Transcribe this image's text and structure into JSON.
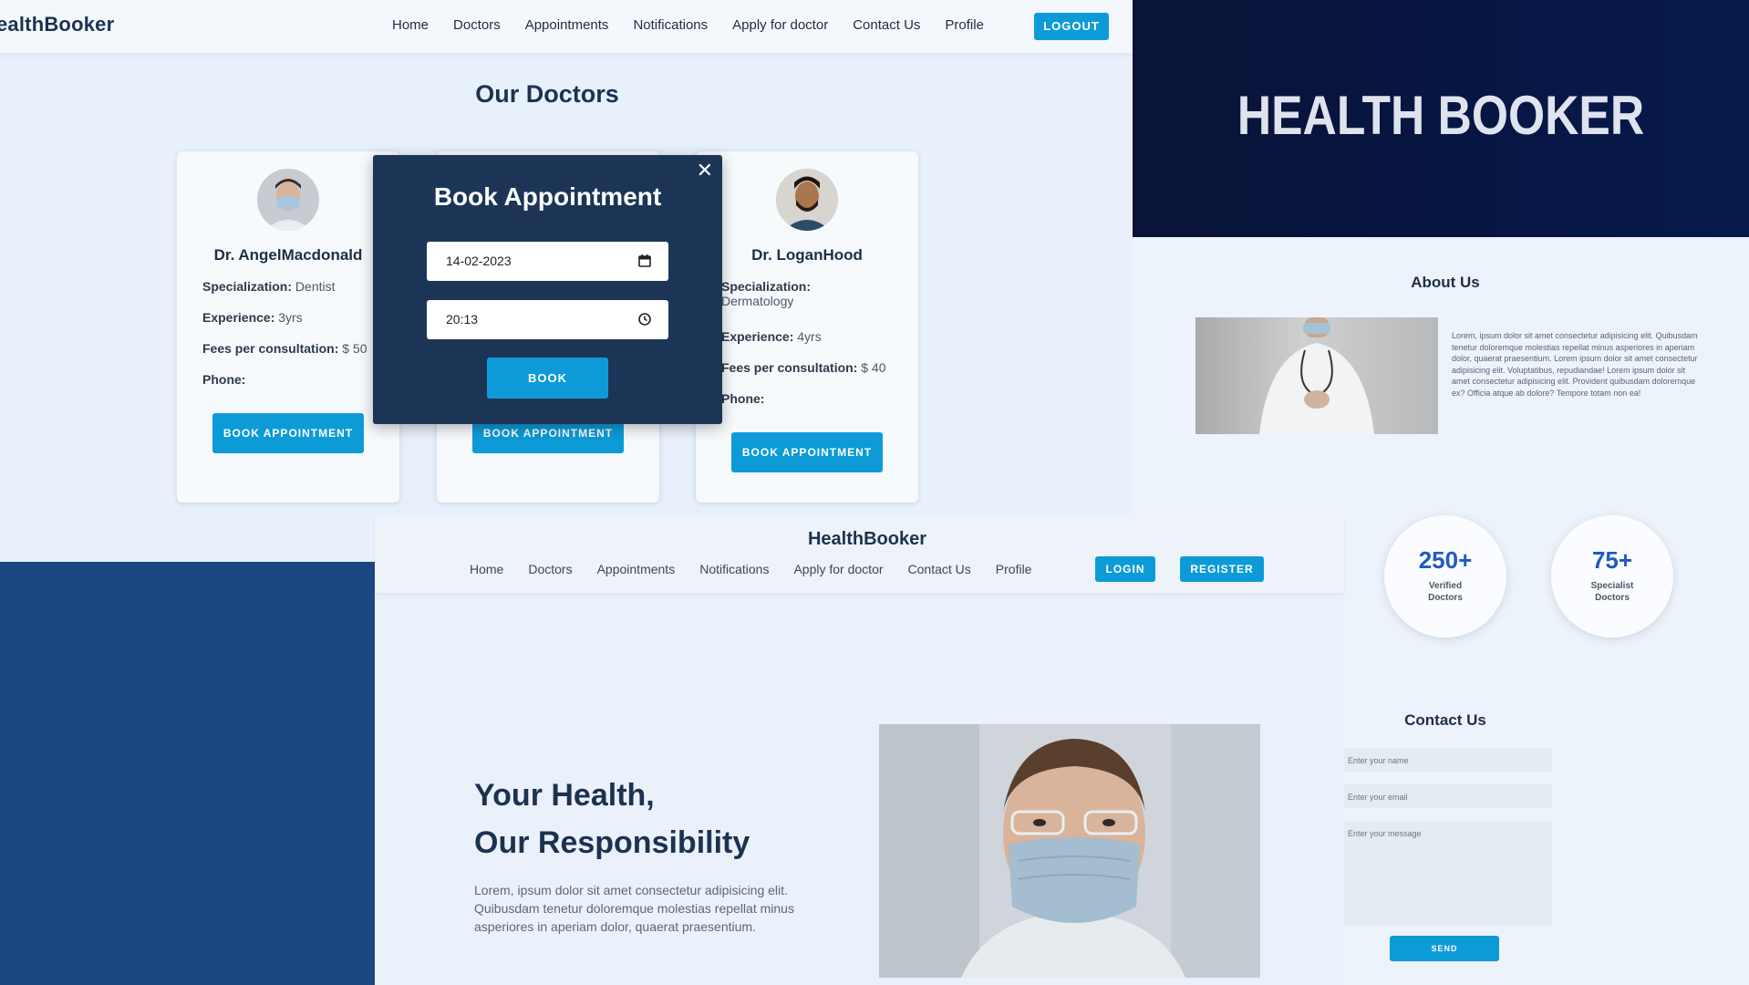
{
  "doctors_page": {
    "brand": "ealthBooker",
    "nav": [
      "Home",
      "Doctors",
      "Appointments",
      "Notifications",
      "Apply for doctor",
      "Contact Us",
      "Profile"
    ],
    "logout_label": "LOGOUT",
    "title": "Our Doctors",
    "doctors": [
      {
        "name": "Dr. AngelMacdonald",
        "spec_label": "Specialization:",
        "spec_value": "Dentist",
        "exp_label": "Experience:",
        "exp_value": "3yrs",
        "fee_label": "Fees per consultation:",
        "fee_value": "$ 50",
        "phone_label": "Phone:",
        "button": "BOOK APPOINTMENT"
      },
      {
        "button": "BOOK APPOINTMENT"
      },
      {
        "name": "Dr. LoganHood",
        "spec_label": "Specialization:",
        "spec_value": "Dermatology",
        "exp_label": "Experience:",
        "exp_value": "4yrs",
        "fee_label": "Fees per consultation:",
        "fee_value": "$ 40",
        "phone_label": "Phone:",
        "button": "BOOK APPOINTMENT"
      }
    ],
    "modal": {
      "title": "Book Appointment",
      "close": "✕",
      "date_value": "14-02-2023",
      "time_value": "20:13",
      "book_label": "BOOK"
    }
  },
  "banner": {
    "title": "HEALTH BOOKER"
  },
  "about": {
    "title": "About Us",
    "text": "Lorem, ipsum dolor sit amet consectetur adipisicing elit. Quibusdam tenetur doloremque molestias repellat minus asperiores in aperiam dolor, quaerat praesentium. Lorem ipsum dolor sit amet consectetur adipisicing elit. Voluptatibus, repudiandae! Lorem ipsum dolor sit amet consectetur adipisicing elit. Provident quibusdam doloremque ex? Officia atque ab dolore? Tempore totam non ea!",
    "stats": [
      {
        "value": "250+",
        "label_line1": "Verified",
        "label_line2": "Doctors"
      },
      {
        "value": "75+",
        "label_line1": "Specialist",
        "label_line2": "Doctors"
      }
    ]
  },
  "contact": {
    "title": "Contact Us",
    "name_placeholder": "Enter your name",
    "email_placeholder": "Enter your email",
    "message_placeholder": "Enter your message",
    "send_label": "SEND"
  },
  "home_page": {
    "brand": "HealthBooker",
    "nav": [
      "Home",
      "Doctors",
      "Appointments",
      "Notifications",
      "Apply for doctor",
      "Contact Us",
      "Profile"
    ],
    "login_label": "LOGIN",
    "register_label": "REGISTER",
    "hero_line1": "Your Health,",
    "hero_line2": "Our Responsibility",
    "hero_text": "Lorem, ipsum dolor sit amet consectetur adipisicing elit. Quibusdam tenetur doloremque molestias repellat minus asperiores in aperiam dolor, quaerat praesentium."
  },
  "colors": {
    "accent": "#0d9bd8",
    "navy": "#1c3557",
    "banner": "#071542",
    "block_blue": "#1c4782"
  }
}
